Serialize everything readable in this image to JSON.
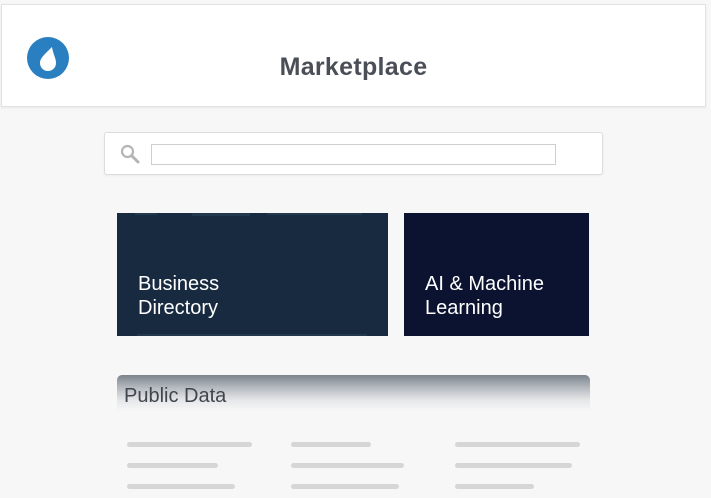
{
  "header": {
    "logo_icon": "water-drop-icon",
    "title": "Marketplace",
    "accent_color": "#2a7fc0"
  },
  "search": {
    "icon": "search-icon",
    "value": "",
    "placeholder": ""
  },
  "categories": [
    {
      "label_line1": "Business",
      "label_line2": "Directory",
      "color": "#172a3f"
    },
    {
      "label_line1": "AI & Machine",
      "label_line2": "Learning",
      "color": "#0c1330"
    }
  ],
  "public_data": {
    "title": "Public Data"
  }
}
